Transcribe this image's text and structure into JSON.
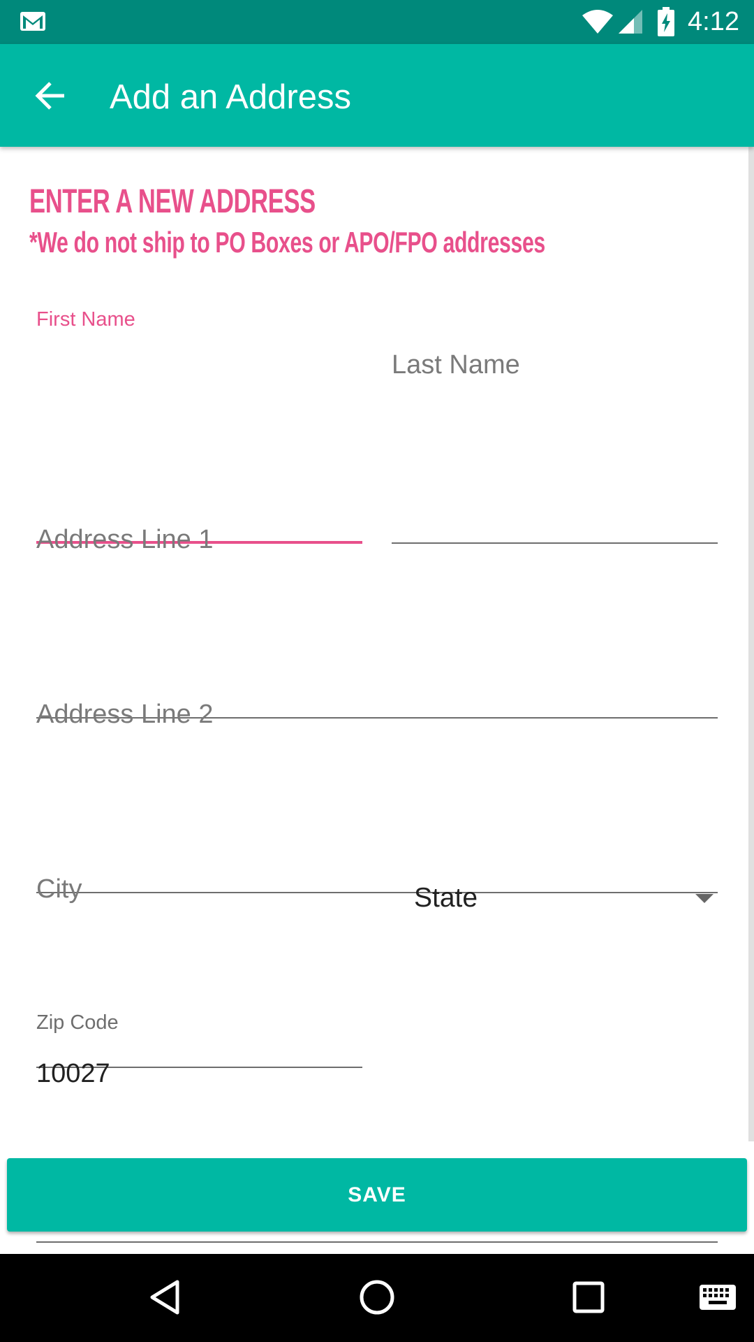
{
  "status_bar": {
    "time": "4:12",
    "icons": [
      "gmail-icon",
      "wifi-icon",
      "signal-icon",
      "battery-charging-icon"
    ]
  },
  "app_bar": {
    "title": "Add an Address",
    "back_icon": "arrow-back-icon"
  },
  "form": {
    "heading": "ENTER A NEW ADDRESS",
    "subheading": "*We do not ship to PO Boxes or APO/FPO addresses",
    "first_name": {
      "label": "First Name",
      "value": ""
    },
    "last_name": {
      "placeholder": "Last Name",
      "value": ""
    },
    "address_line_1": {
      "placeholder": "Address Line 1",
      "value": ""
    },
    "address_line_2": {
      "placeholder": "Address Line 2",
      "value": ""
    },
    "city": {
      "placeholder": "City",
      "value": ""
    },
    "state": {
      "selected": "State"
    },
    "zip_code": {
      "label": "Zip Code",
      "value": "10027"
    }
  },
  "actions": {
    "save_label": "SAVE"
  },
  "nav_bar": {
    "icons": [
      "back-triangle-icon",
      "home-circle-icon",
      "recents-square-icon",
      "keyboard-icon"
    ]
  },
  "colors": {
    "status_bar": "#00897b",
    "app_bar": "#00b8a3",
    "accent_pink": "#e8508b",
    "button": "#00b8a3"
  }
}
